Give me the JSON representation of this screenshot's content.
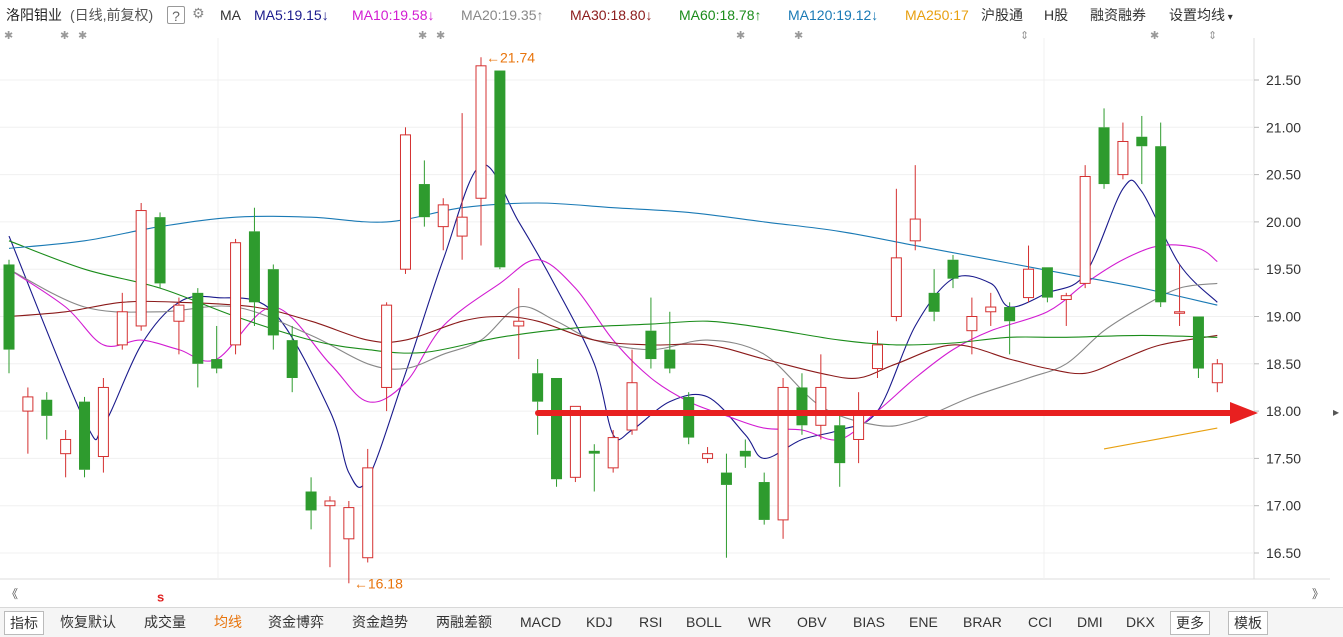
{
  "header": {
    "stock_name": "洛阳钼业",
    "mode": "(日线,前复权)",
    "help": "?",
    "ma_label": "MA",
    "ma_items": [
      {
        "label": "MA5:19.15",
        "arrow": "↓",
        "color": "#1a1a8c"
      },
      {
        "label": "MA10:19.58",
        "arrow": "↓",
        "color": "#d21cd2"
      },
      {
        "label": "MA20:19.35",
        "arrow": "↑",
        "color": "#888888"
      },
      {
        "label": "MA30:18.80",
        "arrow": "↓",
        "color": "#8b1a1a"
      },
      {
        "label": "MA60:18.78",
        "arrow": "↑",
        "color": "#1a8c1a"
      },
      {
        "label": "MA120:19.12",
        "arrow": "↓",
        "color": "#1a7ab5"
      },
      {
        "label": "MA250:17",
        "arrow": "",
        "color": "#e8a010"
      }
    ],
    "buttons": {
      "hsgt": "沪股通",
      "h_share": "H股",
      "margin": "融资融券",
      "settings": "设置均线"
    }
  },
  "toolbar_tabs": [
    "指标",
    "恢复默认",
    "成交量",
    "均线",
    "资金博弈",
    "资金趋势",
    "两融差额",
    "MACD",
    "KDJ",
    "RSI",
    "BOLL",
    "WR",
    "OBV",
    "BIAS",
    "ENE",
    "BRAR",
    "CCI",
    "DMI",
    "DKX",
    "更多",
    "模板"
  ],
  "active_tab": "均线",
  "colors": {
    "up": "#d43030",
    "down": "#2e9b2e",
    "arrow": "#e82020",
    "annotation": "#e8740c"
  },
  "chart_data": {
    "type": "candlestick",
    "ylim": [
      16.1,
      21.95
    ],
    "y_ticks": [
      "21.50",
      "21.00",
      "20.50",
      "20.00",
      "19.50",
      "19.00",
      "18.50",
      "18.00",
      "17.50",
      "17.00",
      "16.50"
    ],
    "annotations": {
      "high": "21.74",
      "low": "16.18",
      "marker": "s"
    },
    "support_line": 17.98,
    "candles": [
      {
        "o": 19.55,
        "c": 18.65,
        "h": 19.6,
        "l": 18.4
      },
      {
        "o": 18.0,
        "c": 18.15,
        "h": 18.25,
        "l": 17.55
      },
      {
        "o": 18.12,
        "c": 17.95,
        "h": 18.2,
        "l": 17.7
      },
      {
        "o": 17.55,
        "c": 17.7,
        "h": 17.8,
        "l": 17.3
      },
      {
        "o": 18.1,
        "c": 17.38,
        "h": 18.15,
        "l": 17.3
      },
      {
        "o": 17.52,
        "c": 18.25,
        "h": 18.35,
        "l": 17.35
      },
      {
        "o": 18.7,
        "c": 19.05,
        "h": 19.25,
        "l": 18.65
      },
      {
        "o": 18.9,
        "c": 20.12,
        "h": 20.2,
        "l": 18.85
      },
      {
        "o": 20.05,
        "c": 19.35,
        "h": 20.1,
        "l": 19.3
      },
      {
        "o": 18.95,
        "c": 19.12,
        "h": 19.2,
        "l": 18.6
      },
      {
        "o": 19.25,
        "c": 18.5,
        "h": 19.3,
        "l": 18.25
      },
      {
        "o": 18.55,
        "c": 18.45,
        "h": 18.9,
        "l": 18.4
      },
      {
        "o": 18.7,
        "c": 19.78,
        "h": 19.82,
        "l": 18.6
      },
      {
        "o": 19.9,
        "c": 19.15,
        "h": 20.15,
        "l": 18.9
      },
      {
        "o": 19.5,
        "c": 18.8,
        "h": 19.55,
        "l": 18.65
      },
      {
        "o": 18.75,
        "c": 18.35,
        "h": 18.9,
        "l": 18.2
      },
      {
        "o": 17.15,
        "c": 16.95,
        "h": 17.3,
        "l": 16.75
      },
      {
        "o": 17.0,
        "c": 17.05,
        "h": 17.1,
        "l": 16.35
      },
      {
        "o": 16.65,
        "c": 16.98,
        "h": 17.05,
        "l": 16.18
      },
      {
        "o": 16.45,
        "c": 17.4,
        "h": 17.6,
        "l": 16.4
      },
      {
        "o": 18.25,
        "c": 19.12,
        "h": 19.15,
        "l": 18.0
      },
      {
        "o": 19.5,
        "c": 20.92,
        "h": 21.0,
        "l": 19.45
      },
      {
        "o": 20.4,
        "c": 20.05,
        "h": 20.65,
        "l": 19.95
      },
      {
        "o": 19.95,
        "c": 20.18,
        "h": 20.25,
        "l": 19.7
      },
      {
        "o": 19.85,
        "c": 20.05,
        "h": 21.15,
        "l": 19.6
      },
      {
        "o": 20.25,
        "c": 21.65,
        "h": 21.74,
        "l": 19.75
      },
      {
        "o": 21.6,
        "c": 19.52,
        "h": 21.6,
        "l": 19.5
      },
      {
        "o": 18.9,
        "c": 18.95,
        "h": 19.3,
        "l": 18.55
      },
      {
        "o": 18.4,
        "c": 18.1,
        "h": 18.55,
        "l": 17.75
      },
      {
        "o": 18.35,
        "c": 17.28,
        "h": 18.35,
        "l": 17.2
      },
      {
        "o": 17.3,
        "c": 18.05,
        "h": 18.05,
        "l": 17.25
      },
      {
        "o": 17.58,
        "c": 17.55,
        "h": 17.65,
        "l": 17.15
      },
      {
        "o": 17.4,
        "c": 17.72,
        "h": 17.8,
        "l": 17.35
      },
      {
        "o": 17.8,
        "c": 18.3,
        "h": 18.65,
        "l": 17.75
      },
      {
        "o": 18.85,
        "c": 18.55,
        "h": 19.2,
        "l": 18.45
      },
      {
        "o": 18.65,
        "c": 18.45,
        "h": 19.05,
        "l": 18.4
      },
      {
        "o": 18.15,
        "c": 17.72,
        "h": 18.2,
        "l": 17.65
      },
      {
        "o": 17.5,
        "c": 17.55,
        "h": 17.62,
        "l": 17.45
      },
      {
        "o": 17.35,
        "c": 17.22,
        "h": 17.55,
        "l": 16.45
      },
      {
        "o": 17.58,
        "c": 17.52,
        "h": 17.7,
        "l": 17.4
      },
      {
        "o": 17.25,
        "c": 16.85,
        "h": 17.35,
        "l": 16.8
      },
      {
        "o": 16.85,
        "c": 18.25,
        "h": 18.35,
        "l": 16.65
      },
      {
        "o": 18.25,
        "c": 17.85,
        "h": 18.4,
        "l": 17.75
      },
      {
        "o": 17.85,
        "c": 18.25,
        "h": 18.6,
        "l": 17.7
      },
      {
        "o": 17.85,
        "c": 17.45,
        "h": 17.95,
        "l": 17.2
      },
      {
        "o": 17.7,
        "c": 18.0,
        "h": 18.2,
        "l": 17.45
      },
      {
        "o": 18.45,
        "c": 18.7,
        "h": 18.85,
        "l": 18.35
      },
      {
        "o": 19.0,
        "c": 19.62,
        "h": 20.35,
        "l": 18.95
      },
      {
        "o": 19.8,
        "c": 20.03,
        "h": 20.6,
        "l": 19.7
      },
      {
        "o": 19.25,
        "c": 19.05,
        "h": 19.5,
        "l": 18.95
      },
      {
        "o": 19.6,
        "c": 19.4,
        "h": 19.65,
        "l": 19.3
      },
      {
        "o": 18.85,
        "c": 19.0,
        "h": 19.2,
        "l": 18.6
      },
      {
        "o": 19.05,
        "c": 19.1,
        "h": 19.25,
        "l": 18.9
      },
      {
        "o": 19.1,
        "c": 18.95,
        "h": 19.15,
        "l": 18.6
      },
      {
        "o": 19.2,
        "c": 19.5,
        "h": 19.75,
        "l": 19.15
      },
      {
        "o": 19.52,
        "c": 19.2,
        "h": 19.52,
        "l": 19.15
      },
      {
        "o": 19.18,
        "c": 19.22,
        "h": 19.25,
        "l": 18.9
      },
      {
        "o": 19.35,
        "c": 20.48,
        "h": 20.6,
        "l": 19.3
      },
      {
        "o": 21.0,
        "c": 20.4,
        "h": 21.2,
        "l": 20.35
      },
      {
        "o": 20.5,
        "c": 20.85,
        "h": 21.05,
        "l": 20.45
      },
      {
        "o": 20.9,
        "c": 20.8,
        "h": 21.12,
        "l": 20.4
      },
      {
        "o": 20.8,
        "c": 19.15,
        "h": 21.05,
        "l": 19.1
      },
      {
        "o": 19.05,
        "c": 19.05,
        "h": 19.55,
        "l": 18.9
      },
      {
        "o": 19.0,
        "c": 18.45,
        "h": 19.0,
        "l": 18.35
      },
      {
        "o": 18.3,
        "c": 18.5,
        "h": 18.55,
        "l": 18.2
      }
    ],
    "ma_lines": [
      {
        "name": "MA5",
        "color": "#1a1a8c",
        "values": [
          [
            0,
            19.85
          ],
          [
            4,
            17.9
          ],
          [
            5,
            17.85
          ],
          [
            7,
            18.7
          ],
          [
            9,
            19.15
          ],
          [
            11,
            19.2
          ],
          [
            14,
            19.05
          ],
          [
            17,
            18.0
          ],
          [
            18,
            17.35
          ],
          [
            19,
            17.28
          ],
          [
            21,
            18.4
          ],
          [
            23,
            19.6
          ],
          [
            25,
            20.6
          ],
          [
            27,
            20.0
          ],
          [
            29,
            19.3
          ],
          [
            31,
            18.5
          ],
          [
            32,
            17.75
          ],
          [
            33,
            17.8
          ],
          [
            35,
            18.1
          ],
          [
            37,
            18.15
          ],
          [
            39,
            17.75
          ],
          [
            40,
            17.5
          ],
          [
            42,
            17.7
          ],
          [
            44,
            17.8
          ],
          [
            46,
            18.0
          ],
          [
            48,
            18.9
          ],
          [
            50,
            19.4
          ],
          [
            52,
            19.35
          ],
          [
            53,
            19.1
          ],
          [
            55,
            19.25
          ],
          [
            57,
            19.45
          ],
          [
            59,
            20.35
          ],
          [
            60,
            20.32
          ],
          [
            62,
            19.55
          ],
          [
            64,
            19.15
          ]
        ]
      },
      {
        "name": "MA10",
        "color": "#d21cd2",
        "values": [
          [
            0,
            19.5
          ],
          [
            3,
            19.1
          ],
          [
            5,
            18.7
          ],
          [
            7,
            18.75
          ],
          [
            9,
            18.65
          ],
          [
            11,
            18.55
          ],
          [
            14,
            19.1
          ],
          [
            17,
            18.5
          ],
          [
            19,
            18.1
          ],
          [
            21,
            18.3
          ],
          [
            23,
            18.9
          ],
          [
            26,
            19.35
          ],
          [
            28,
            19.6
          ],
          [
            30,
            19.3
          ],
          [
            32,
            18.75
          ],
          [
            34,
            18.35
          ],
          [
            36,
            18.1
          ],
          [
            38,
            17.95
          ],
          [
            40,
            17.82
          ],
          [
            42,
            17.8
          ],
          [
            44,
            17.7
          ],
          [
            46,
            18.0
          ],
          [
            48,
            18.35
          ],
          [
            50,
            18.65
          ],
          [
            52,
            18.85
          ],
          [
            55,
            19.05
          ],
          [
            57,
            19.35
          ],
          [
            59,
            19.6
          ],
          [
            61,
            19.75
          ],
          [
            63,
            19.72
          ],
          [
            64,
            19.58
          ]
        ]
      },
      {
        "name": "MA20",
        "color": "#888888",
        "values": [
          [
            0,
            19.5
          ],
          [
            4,
            19.1
          ],
          [
            8,
            19.05
          ],
          [
            12,
            19.1
          ],
          [
            16,
            18.8
          ],
          [
            19,
            18.5
          ],
          [
            21,
            18.45
          ],
          [
            23,
            18.6
          ],
          [
            25,
            18.75
          ],
          [
            27,
            19.1
          ],
          [
            29,
            18.95
          ],
          [
            31,
            18.75
          ],
          [
            34,
            18.65
          ],
          [
            37,
            18.75
          ],
          [
            40,
            18.6
          ],
          [
            43,
            18.05
          ],
          [
            46,
            17.85
          ],
          [
            48,
            17.9
          ],
          [
            51,
            18.15
          ],
          [
            54,
            18.35
          ],
          [
            56,
            18.5
          ],
          [
            58,
            18.85
          ],
          [
            60,
            19.1
          ],
          [
            62,
            19.3
          ],
          [
            64,
            19.35
          ]
        ]
      },
      {
        "name": "MA30",
        "color": "#8b1a1a",
        "values": [
          [
            0,
            19.0
          ],
          [
            3,
            19.05
          ],
          [
            6,
            19.15
          ],
          [
            9,
            19.15
          ],
          [
            13,
            19.1
          ],
          [
            16,
            18.95
          ],
          [
            19,
            18.75
          ],
          [
            21,
            18.75
          ],
          [
            24,
            18.95
          ],
          [
            26,
            19.0
          ],
          [
            28,
            18.95
          ],
          [
            31,
            18.75
          ],
          [
            34,
            18.7
          ],
          [
            37,
            18.7
          ],
          [
            40,
            18.55
          ],
          [
            43,
            18.4
          ],
          [
            45,
            18.35
          ],
          [
            47,
            18.5
          ],
          [
            50,
            18.7
          ],
          [
            53,
            18.55
          ],
          [
            55,
            18.45
          ],
          [
            57,
            18.4
          ],
          [
            59,
            18.55
          ],
          [
            61,
            18.7
          ],
          [
            64,
            18.8
          ]
        ]
      },
      {
        "name": "MA60",
        "color": "#1a8c1a",
        "values": [
          [
            0,
            19.8
          ],
          [
            4,
            19.5
          ],
          [
            8,
            19.3
          ],
          [
            12,
            19.0
          ],
          [
            16,
            18.75
          ],
          [
            19,
            18.65
          ],
          [
            22,
            18.62
          ],
          [
            26,
            18.78
          ],
          [
            30,
            18.88
          ],
          [
            34,
            18.92
          ],
          [
            37,
            18.95
          ],
          [
            40,
            18.88
          ],
          [
            44,
            18.75
          ],
          [
            47,
            18.7
          ],
          [
            50,
            18.72
          ],
          [
            53,
            18.78
          ],
          [
            56,
            18.78
          ],
          [
            60,
            18.8
          ],
          [
            64,
            18.78
          ]
        ]
      },
      {
        "name": "MA120",
        "color": "#1a7ab5",
        "values": [
          [
            0,
            19.72
          ],
          [
            4,
            19.8
          ],
          [
            8,
            19.95
          ],
          [
            12,
            20.05
          ],
          [
            16,
            20.05
          ],
          [
            20,
            20.0
          ],
          [
            24,
            20.15
          ],
          [
            28,
            20.2
          ],
          [
            32,
            20.15
          ],
          [
            36,
            20.1
          ],
          [
            40,
            20.0
          ],
          [
            44,
            19.9
          ],
          [
            48,
            19.75
          ],
          [
            52,
            19.6
          ],
          [
            56,
            19.45
          ],
          [
            60,
            19.3
          ],
          [
            64,
            19.12
          ]
        ]
      },
      {
        "name": "MA250",
        "color": "#e8a010",
        "values": [
          [
            58,
            17.6
          ],
          [
            64,
            17.82
          ]
        ]
      }
    ]
  }
}
